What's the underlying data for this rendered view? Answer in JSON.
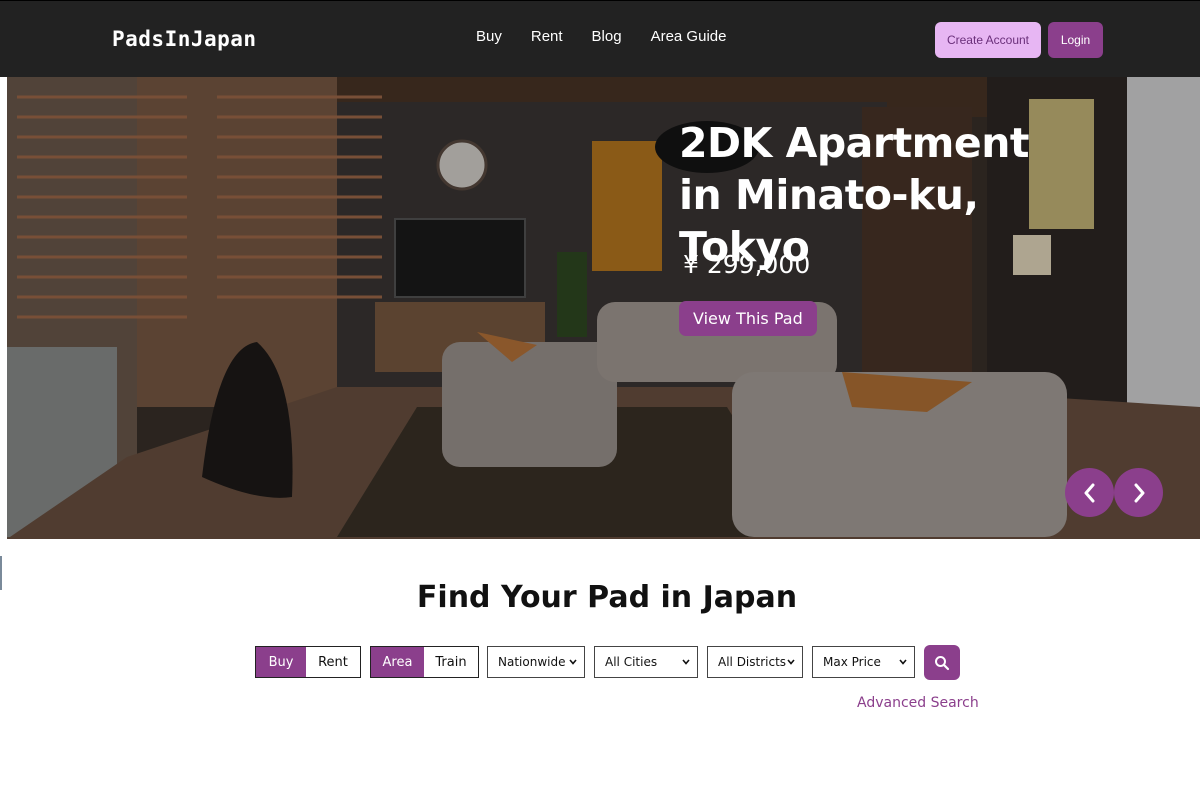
{
  "brand": {
    "logo": "PadsInJapan",
    "accent": "#8b3f8c",
    "accent_light": "#e7b6f3",
    "nav_bg": "#222222"
  },
  "nav": {
    "links": [
      "Buy",
      "Rent",
      "Blog",
      "Area Guide"
    ],
    "create_account": "Create Account",
    "login": "Login"
  },
  "hero": {
    "title": "2DK Apartment in Minato-ku, Tokyo",
    "price": "¥ 299,000",
    "cta": "View This Pad",
    "prev_icon": "chevron-left-icon",
    "next_icon": "chevron-right-icon"
  },
  "search": {
    "title": "Find Your Pad in Japan",
    "listing_type": {
      "options": [
        "Buy",
        "Rent"
      ],
      "selected": "Buy"
    },
    "search_mode": {
      "options": [
        "Area",
        "Train"
      ],
      "selected": "Area"
    },
    "prefecture": "Nationwide",
    "city": "All Cities",
    "district": "All Districts",
    "max_price": "Max Price",
    "search_icon": "search-icon",
    "advanced": "Advanced Search"
  }
}
